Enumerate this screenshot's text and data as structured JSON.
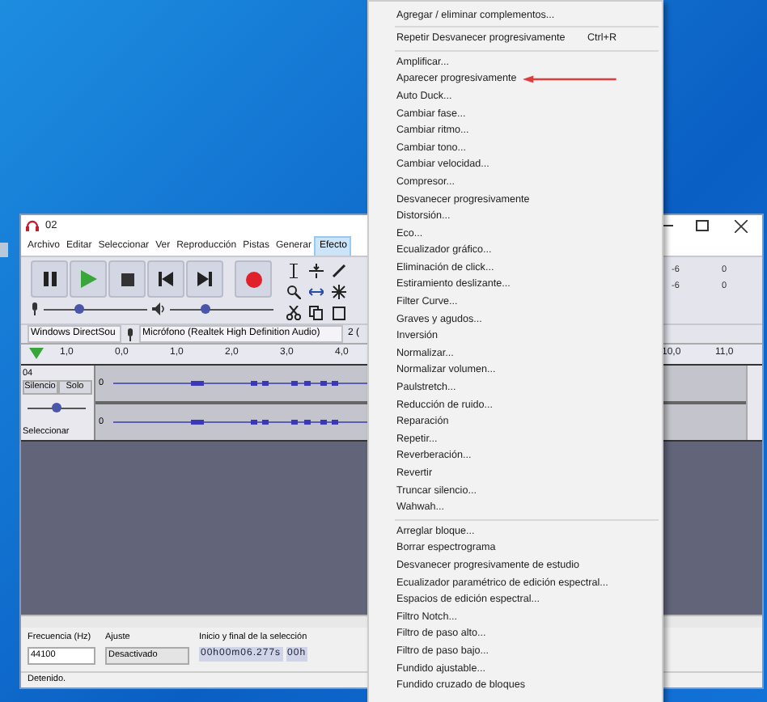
{
  "window": {
    "title": "02"
  },
  "menubar": [
    {
      "label": "Archivo",
      "selected": false
    },
    {
      "label": "Editar",
      "selected": false
    },
    {
      "label": "Seleccionar",
      "selected": false
    },
    {
      "label": "Ver",
      "selected": false
    },
    {
      "label": "Reproducción",
      "selected": false
    },
    {
      "label": "Pistas",
      "selected": false
    },
    {
      "label": "Generar",
      "selected": false
    },
    {
      "label": "Efecto",
      "selected": true
    }
  ],
  "transport": [
    {
      "kind": "pause"
    },
    {
      "kind": "play"
    },
    {
      "kind": "stop"
    },
    {
      "kind": "skip-start"
    },
    {
      "kind": "skip-end"
    },
    {
      "kind": "record"
    }
  ],
  "meters": [
    {
      "kind": "mic",
      "level": 0.35
    },
    {
      "kind": "speaker",
      "level": 0.35
    }
  ],
  "meter_readings": [
    "-6",
    "0",
    "-6",
    "0"
  ],
  "devices": {
    "host": "Windows DirectSou",
    "input": "Micrófono (Realtek High Definition Audio)",
    "channels": "2 ("
  },
  "ruler": [
    "1,0",
    "0,0",
    "1,0",
    "2,0",
    "3,0",
    "4,0",
    "10,0",
    "11,0"
  ],
  "track": {
    "name": "04",
    "mute": "Silencio",
    "solo": "Solo",
    "gain": {
      "level": 0.5
    },
    "select": "Seleccionar",
    "scale": [
      "0",
      "0"
    ]
  },
  "selection_bar": {
    "rate_label": "Frecuencia (Hz)",
    "rate": "44100",
    "snap_label": "Ajuste",
    "snap": "Desactivado",
    "selection_label": "Inicio y final de la selección",
    "start": "00h00m06.277s",
    "end": "00h"
  },
  "status": "Detenido.",
  "effect_menu": [
    {
      "kind": "item",
      "label": "Agregar / eliminar complementos..."
    },
    {
      "kind": "separator"
    },
    {
      "kind": "item",
      "label": "Repetir Desvanecer progresivamente",
      "shortcut": "Ctrl+R"
    },
    {
      "kind": "separator"
    },
    {
      "kind": "item",
      "label": "Amplificar..."
    },
    {
      "kind": "item",
      "label": "Aparecer progresivamente",
      "annotated": true
    },
    {
      "kind": "item",
      "label": "Auto Duck..."
    },
    {
      "kind": "item",
      "label": "Cambiar fase..."
    },
    {
      "kind": "item",
      "label": "Cambiar ritmo..."
    },
    {
      "kind": "item",
      "label": "Cambiar tono..."
    },
    {
      "kind": "item",
      "label": "Cambiar velocidad..."
    },
    {
      "kind": "item",
      "label": "Compresor..."
    },
    {
      "kind": "item",
      "label": "Desvanecer progresivamente"
    },
    {
      "kind": "item",
      "label": "Distorsión..."
    },
    {
      "kind": "item",
      "label": "Eco..."
    },
    {
      "kind": "item",
      "label": "Ecualizador gráfico..."
    },
    {
      "kind": "item",
      "label": "Eliminación de click..."
    },
    {
      "kind": "item",
      "label": "Estiramiento deslizante..."
    },
    {
      "kind": "item",
      "label": "Filter Curve..."
    },
    {
      "kind": "item",
      "label": "Graves y agudos..."
    },
    {
      "kind": "item",
      "label": "Inversión"
    },
    {
      "kind": "item",
      "label": "Normalizar..."
    },
    {
      "kind": "item",
      "label": "Normalizar volumen..."
    },
    {
      "kind": "item",
      "label": "Paulstretch..."
    },
    {
      "kind": "item",
      "label": "Reducción de ruido..."
    },
    {
      "kind": "item",
      "label": "Reparación"
    },
    {
      "kind": "item",
      "label": "Repetir..."
    },
    {
      "kind": "item",
      "label": "Reverberación..."
    },
    {
      "kind": "item",
      "label": "Revertir"
    },
    {
      "kind": "item",
      "label": "Truncar silencio..."
    },
    {
      "kind": "item",
      "label": "Wahwah..."
    },
    {
      "kind": "separator"
    },
    {
      "kind": "item",
      "label": "Arreglar bloque..."
    },
    {
      "kind": "item",
      "label": "Borrar espectrograma"
    },
    {
      "kind": "item",
      "label": "Desvanecer progresivamente de estudio"
    },
    {
      "kind": "item",
      "label": "Ecualizador paramétrico de edición espectral..."
    },
    {
      "kind": "item",
      "label": "Espacios de edición espectral..."
    },
    {
      "kind": "item",
      "label": "Filtro Notch..."
    },
    {
      "kind": "item",
      "label": "Filtro de paso alto..."
    },
    {
      "kind": "item",
      "label": "Filtro de paso bajo..."
    },
    {
      "kind": "item",
      "label": "Fundido ajustable..."
    },
    {
      "kind": "item",
      "label": "Fundido cruzado de bloques"
    }
  ]
}
